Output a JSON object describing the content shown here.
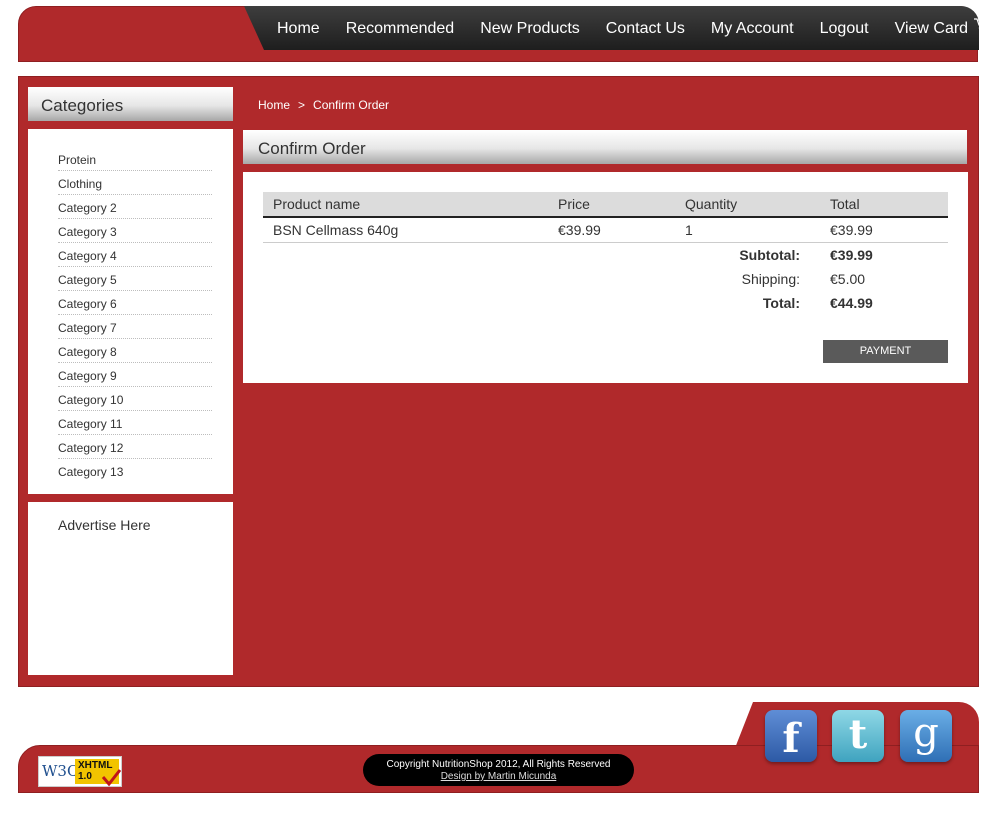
{
  "nav": {
    "items": [
      "Home",
      "Recommended",
      "New Products",
      "Contact Us",
      "My Account",
      "Logout",
      "View Card"
    ],
    "cart_icon": "shopping-cart-icon"
  },
  "sidebar": {
    "title": "Categories",
    "categories": [
      "Protein",
      "Clothing",
      "Category 2",
      "Category 3",
      "Category 4",
      "Category 5",
      "Category 6",
      "Category 7",
      "Category 8",
      "Category 9",
      "Category 10",
      "Category 11",
      "Category 12",
      "Category 13"
    ],
    "advert": "Advertise Here"
  },
  "breadcrumb": {
    "home": "Home",
    "separator": ">",
    "current": "Confirm Order"
  },
  "page_title": "Confirm Order",
  "order": {
    "headers": [
      "Product name",
      "Price",
      "Quantity",
      "Total"
    ],
    "items": [
      {
        "name": "BSN Cellmass 640g",
        "price": "€39.99",
        "quantity": "1",
        "total": "€39.99"
      }
    ],
    "subtotal_label": "Subtotal:",
    "subtotal": "€39.99",
    "shipping_label": "Shipping:",
    "shipping": "€5.00",
    "total_label": "Total:",
    "total": "€44.99",
    "payment_button": "PAYMENT"
  },
  "footer": {
    "w3c_badge": {
      "w3c": "W3C",
      "line1": "XHTML",
      "line2": "1.0"
    },
    "copyright": "Copyright NutritionShop 2012, All Rights Reserved",
    "design_credit": "Design by Martin Micunda",
    "social": [
      {
        "icon": "facebook-icon",
        "glyph": "f"
      },
      {
        "icon": "twitter-icon",
        "glyph": "t"
      },
      {
        "icon": "google-icon",
        "glyph": "g"
      }
    ]
  },
  "colors": {
    "brand_red": "#b0292b",
    "nav_dark": "#2a2a2a",
    "button_gray": "#5a5a5a"
  }
}
